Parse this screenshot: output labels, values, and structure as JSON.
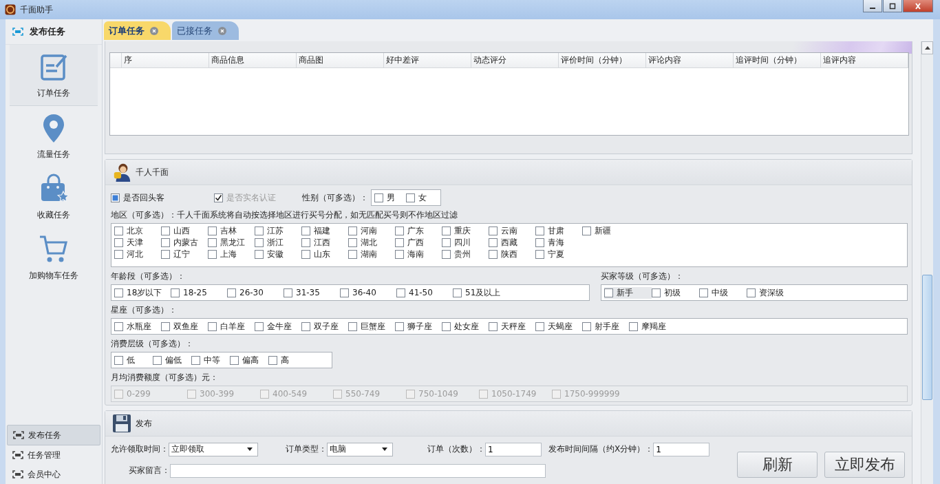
{
  "window": {
    "title": "千面助手"
  },
  "sidebar": {
    "header": "发布任务",
    "items": [
      {
        "kind": "order",
        "label": "订单任务",
        "selected": true
      },
      {
        "kind": "traffic",
        "label": "流量任务",
        "selected": false
      },
      {
        "kind": "favorite",
        "label": "收藏任务",
        "selected": false
      },
      {
        "kind": "cart",
        "label": "加购物车任务",
        "selected": false
      }
    ],
    "bottom_items": [
      {
        "label": "发布任务",
        "selected": true
      },
      {
        "label": "任务管理",
        "selected": false
      },
      {
        "label": "会员中心",
        "selected": false
      }
    ]
  },
  "tabs": [
    {
      "label": "订单任务",
      "selected": true
    },
    {
      "label": "已接任务",
      "selected": false
    }
  ],
  "review_table": {
    "columns": [
      "序",
      "商品信息",
      "商品图",
      "好中差评",
      "动态评分",
      "评价时间（分钟）",
      "评论内容",
      "追评时间（分钟）",
      "追评内容"
    ]
  },
  "targeting": {
    "title": "千人千面",
    "returning_customer": {
      "label": "是否回头客",
      "checked": true,
      "disabled": false
    },
    "real_name": {
      "label": "是否实名认证",
      "checked": true,
      "disabled": true
    },
    "gender": {
      "label": "性别（可多选）：",
      "options": [
        {
          "label": "男",
          "checked": false
        },
        {
          "label": "女",
          "checked": false
        }
      ]
    },
    "region": {
      "label": "地区（可多选）：千人千面系统将自动按选择地区进行买号分配，如无匹配买号则不作地区过滤",
      "rows": [
        [
          {
            "label": "北京",
            "checked": false
          },
          {
            "label": "山西",
            "checked": false
          },
          {
            "label": "吉林",
            "checked": false
          },
          {
            "label": "江苏",
            "checked": false
          },
          {
            "label": "福建",
            "checked": false
          },
          {
            "label": "河南",
            "checked": false
          },
          {
            "label": "广东",
            "checked": false
          },
          {
            "label": "重庆",
            "checked": false
          },
          {
            "label": "云南",
            "checked": false
          },
          {
            "label": "甘肃",
            "checked": false
          },
          {
            "label": "新疆",
            "checked": false
          }
        ],
        [
          {
            "label": "天津",
            "checked": false
          },
          {
            "label": "内蒙古",
            "checked": false
          },
          {
            "label": "黑龙江",
            "checked": false
          },
          {
            "label": "浙江",
            "checked": false
          },
          {
            "label": "江西",
            "checked": false
          },
          {
            "label": "湖北",
            "checked": false
          },
          {
            "label": "广西",
            "checked": false
          },
          {
            "label": "四川",
            "checked": false
          },
          {
            "label": "西藏",
            "checked": false
          },
          {
            "label": "青海",
            "checked": false
          }
        ],
        [
          {
            "label": "河北",
            "checked": false
          },
          {
            "label": "辽宁",
            "checked": false
          },
          {
            "label": "上海",
            "checked": false
          },
          {
            "label": "安徽",
            "checked": false
          },
          {
            "label": "山东",
            "checked": false
          },
          {
            "label": "湖南",
            "checked": false
          },
          {
            "label": "海南",
            "checked": false
          },
          {
            "label": "贵州",
            "checked": false
          },
          {
            "label": "陕西",
            "checked": false
          },
          {
            "label": "宁夏",
            "checked": false
          }
        ]
      ]
    },
    "age": {
      "label": "年龄段（可多选）：",
      "options": [
        {
          "label": "18岁以下",
          "checked": false
        },
        {
          "label": "18-25",
          "checked": false
        },
        {
          "label": "26-30",
          "checked": false
        },
        {
          "label": "31-35",
          "checked": false
        },
        {
          "label": "36-40",
          "checked": false
        },
        {
          "label": "41-50",
          "checked": false
        },
        {
          "label": "51及以上",
          "checked": false
        }
      ]
    },
    "buyer_level": {
      "label": "买家等级（可多选）：",
      "options": [
        {
          "label": "新手",
          "checked": false,
          "highlighted": true
        },
        {
          "label": "初级",
          "checked": false,
          "highlighted": false
        },
        {
          "label": "中级",
          "checked": false,
          "highlighted": false
        },
        {
          "label": "资深级",
          "checked": false,
          "highlighted": false
        }
      ]
    },
    "constellation": {
      "label": "星座（可多选）：",
      "options": [
        {
          "label": "水瓶座",
          "checked": false
        },
        {
          "label": "双鱼座",
          "checked": false
        },
        {
          "label": "白羊座",
          "checked": false
        },
        {
          "label": "金牛座",
          "checked": false
        },
        {
          "label": "双子座",
          "checked": false
        },
        {
          "label": "巨蟹座",
          "checked": false
        },
        {
          "label": "狮子座",
          "checked": false
        },
        {
          "label": "处女座",
          "checked": false
        },
        {
          "label": "天秤座",
          "checked": false
        },
        {
          "label": "天蝎座",
          "checked": false
        },
        {
          "label": "射手座",
          "checked": false
        },
        {
          "label": "摩羯座",
          "checked": false
        }
      ]
    },
    "consumption": {
      "label": "消费层级（可多选）：",
      "options": [
        {
          "label": "低",
          "checked": false
        },
        {
          "label": "偏低",
          "checked": false
        },
        {
          "label": "中等",
          "checked": false
        },
        {
          "label": "偏高",
          "checked": false
        },
        {
          "label": "高",
          "checked": false
        }
      ]
    },
    "monthly_spend": {
      "label": "月均消费额度（可多选）元：",
      "disabled": true,
      "options": [
        {
          "label": "0-299",
          "checked": false
        },
        {
          "label": "300-399",
          "checked": false
        },
        {
          "label": "400-549",
          "checked": false
        },
        {
          "label": "550-749",
          "checked": false
        },
        {
          "label": "750-1049",
          "checked": false
        },
        {
          "label": "1050-1749",
          "checked": false
        },
        {
          "label": "1750-999999",
          "checked": false
        }
      ]
    }
  },
  "publish": {
    "title": "发布",
    "claim_time": {
      "label": "允许领取时间：",
      "value": "立即领取"
    },
    "order_type": {
      "label": "订单类型：",
      "value": "电脑"
    },
    "order_count": {
      "label": "订单（次数）：",
      "value": "1"
    },
    "interval": {
      "label": "发布时间间隔（约X分钟）：",
      "value": "1"
    },
    "buyer_message": {
      "label": "买家留言："
    },
    "buttons": [
      "刷新",
      "立即发布"
    ]
  }
}
